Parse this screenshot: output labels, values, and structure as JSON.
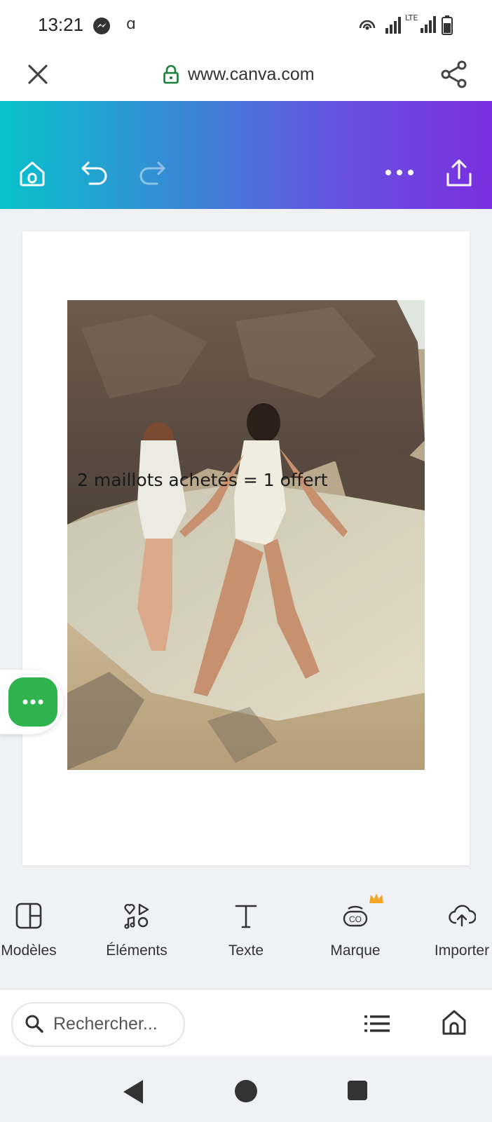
{
  "status_bar": {
    "time": "13:21",
    "extra_glyph": "ɑ",
    "network": "LTE"
  },
  "browser": {
    "url": "www.canva.com",
    "icons": [
      "close-icon",
      "lock-icon",
      "share-icon"
    ]
  },
  "editor_toolbar": {
    "icons": [
      "home-icon",
      "undo-icon",
      "redo-icon",
      "more-icon",
      "export-icon"
    ],
    "gradient": [
      "#07c2cb",
      "#7a2fe0"
    ]
  },
  "design": {
    "overlay_text": "2 maillots achetés = 1 offert"
  },
  "tools": [
    {
      "label": "Modèles",
      "icon": "templates-icon"
    },
    {
      "label": "Éléments",
      "icon": "elements-icon"
    },
    {
      "label": "Texte",
      "icon": "text-icon"
    },
    {
      "label": "Marque",
      "icon": "brand-icon",
      "badge": "crown-icon"
    },
    {
      "label": "Importer",
      "icon": "upload-icon"
    }
  ],
  "search": {
    "placeholder": "Rechercher..."
  },
  "colors": {
    "fab": "#2fb34e",
    "lock": "#1a7f37",
    "crown": "#f5a623"
  }
}
